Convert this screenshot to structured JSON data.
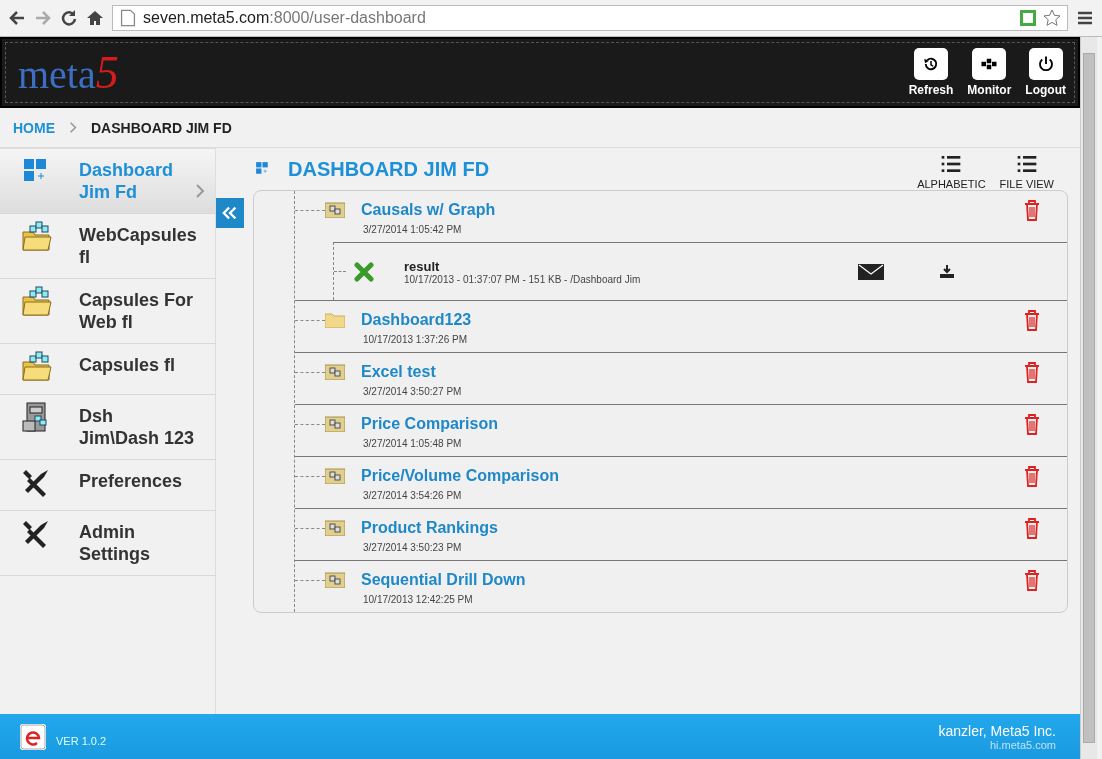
{
  "browser": {
    "url_host": "seven.meta5.com",
    "url_path": ":8000/user-dashboard"
  },
  "header": {
    "logo_text": "meta",
    "logo_digit": "5",
    "buttons": [
      {
        "label": "Refresh",
        "kind": "history"
      },
      {
        "label": "Monitor",
        "kind": "monitor"
      },
      {
        "label": "Logout",
        "kind": "power"
      }
    ]
  },
  "breadcrumb": [
    {
      "label": "HOME",
      "current": false
    },
    {
      "label": "DASHBOARD JIM FD",
      "current": true
    }
  ],
  "sidebar": {
    "items": [
      {
        "label": "Dashboard Jim Fd",
        "kind": "dashboard",
        "selected": true
      },
      {
        "label": "WebCapsules fl",
        "kind": "capsule-folder",
        "selected": false
      },
      {
        "label": "Capsules For Web fl",
        "kind": "capsule-folder",
        "selected": false
      },
      {
        "label": "Capsules fl",
        "kind": "capsule-folder",
        "selected": false
      },
      {
        "label": "Dsh Jim\\Dash 123",
        "kind": "cabinet",
        "selected": false
      },
      {
        "label": "Preferences",
        "kind": "tools",
        "selected": false
      },
      {
        "label": "Admin Settings",
        "kind": "tools",
        "selected": false
      }
    ]
  },
  "main": {
    "title": "DASHBOARD JIM FD",
    "views": [
      {
        "label": "ALPHABETIC"
      },
      {
        "label": "FILE VIEW"
      }
    ],
    "items": [
      {
        "name": "Causals w/ Graph",
        "date": "3/27/2014 1:05:42 PM",
        "kind": "capsule",
        "children": [
          {
            "name": "result",
            "details": "10/17/2013 - 01:37:07 PM - 151 KB - /Dashboard Jim",
            "kind": "excel"
          }
        ]
      },
      {
        "name": "Dashboard123",
        "date": "10/17/2013 1:37:26 PM",
        "kind": "folder"
      },
      {
        "name": "Excel test",
        "date": "3/27/2014 3:50:27 PM",
        "kind": "capsule"
      },
      {
        "name": "Price Comparison",
        "date": "3/27/2014 1:05:48 PM",
        "kind": "capsule"
      },
      {
        "name": "Price/Volume Comparison",
        "date": "3/27/2014 3:54:26 PM",
        "kind": "capsule"
      },
      {
        "name": "Product Rankings",
        "date": "3/27/2014 3:50:23 PM",
        "kind": "capsule"
      },
      {
        "name": "Sequential Drill Down",
        "date": "10/17/2013 12:42:25 PM",
        "kind": "capsule"
      }
    ]
  },
  "footer": {
    "version": "VER 1.0.2",
    "company": "kanzler, Meta5 Inc.",
    "site": "hi.meta5.com"
  }
}
